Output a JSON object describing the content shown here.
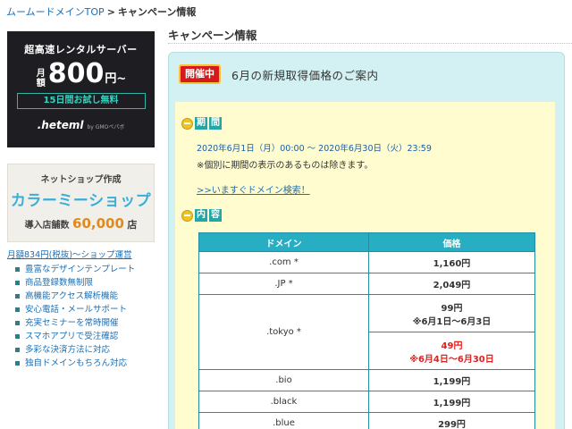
{
  "breadcrumb": {
    "home": "ムームードメインTOP",
    "separator": ">",
    "current": "キャンペーン情報"
  },
  "sidebar": {
    "heteml_banner": {
      "headline": "超高速レンタルサーバー",
      "month_label": "月額",
      "price": "800",
      "price_suffix": "円~",
      "trial": "15日間お試し無料",
      "logo": ".heteml",
      "logo_by": "by GMOペパボ"
    },
    "colorme_banner": {
      "line1": "ネットショップ作成",
      "line2": "カラーミーショップ",
      "line3_prefix": "導入店舗数",
      "line3_number": "60,000",
      "line3_suffix": "店"
    },
    "shop_link": "月額834円(税抜)～ショップ運営",
    "features": [
      "豊富なデザインテンプレート",
      "商品登録数無制限",
      "高機能アクセス解析機能",
      "安心電話・メールサポート",
      "充実セミナーを常時開催",
      "スマホアプリで受注確認",
      "多彩な決済方法に対応",
      "独自ドメインもちろん対応"
    ]
  },
  "main": {
    "title": "キャンペーン情報",
    "badge": "開催中",
    "headline": "6月の新規取得価格のご案内",
    "period_heading": [
      "期",
      "間"
    ],
    "period": "2020年6月1日（月）00:00 〜 2020年6月30日（火）23:59",
    "period_note": "※個別に期間の表示のあるものは除きます。",
    "search_link": ">>いますぐドメイン検索！",
    "content_heading": [
      "内",
      "容"
    ],
    "table": {
      "headers": [
        "ドメイン",
        "価格"
      ],
      "rows": [
        {
          "domain": ".com *",
          "price": "1,160円"
        },
        {
          "domain": ".JP *",
          "price": "2,049円"
        },
        {
          "domain": ".tokyo *",
          "price": "99円",
          "note": "※6月1日～6月3日",
          "sale_price": "49円",
          "sale_note": "※6月4日～6月30日"
        },
        {
          "domain": ".bio",
          "price": "1,199円"
        },
        {
          "domain": ".black",
          "price": "1,199円"
        }
      ],
      "partial_row": {
        "domain": ".blue",
        "price": "299円"
      }
    }
  },
  "colors": {
    "link": "#1a6fb5",
    "panel_bg": "#d3f0f2",
    "inner_bg": "#fffdd0",
    "table_header": "#27aec2",
    "badge": "#d41b1b",
    "sale": "#e0221f"
  }
}
